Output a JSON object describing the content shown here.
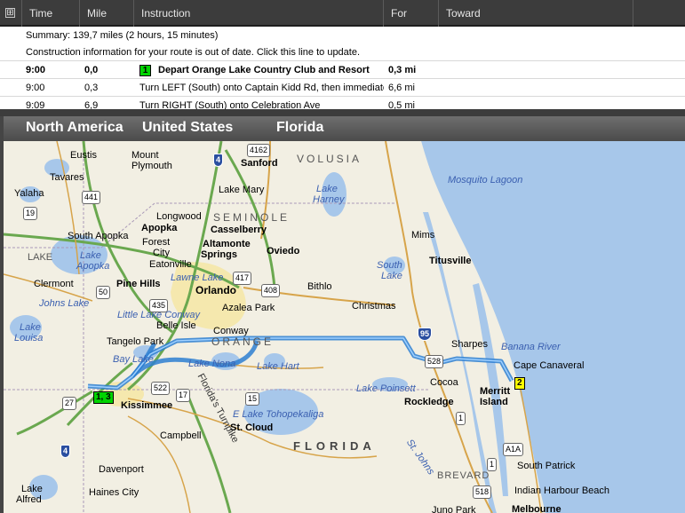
{
  "directions": {
    "expand_icon": "⊞",
    "columns": [
      "Time",
      "Mile",
      "Instruction",
      "For",
      "Toward"
    ],
    "summary": "Summary:  139,7 miles (2 hours, 15 minutes)",
    "construction": "Construction information for your route is out of date.  Click this line to update.",
    "steps": [
      {
        "time": "9:00",
        "mile": "0,0",
        "badge": "1",
        "instruction": "Depart Orange Lake Country Club and Resort",
        "for": "0,3 mi"
      },
      {
        "time": "9:00",
        "mile": "0,3",
        "instruction": "Turn LEFT (South) onto Captain Kidd Rd, then immediatel",
        "for": "6,6 mi"
      },
      {
        "time": "9:09",
        "mile": "6,9",
        "instruction": "Turn RIGHT (South) onto Celebration Ave",
        "for": "0,5 mi"
      }
    ]
  },
  "breadcrumb": [
    "North America",
    "United States",
    "Florida"
  ],
  "map": {
    "cities": [
      "Eustis",
      "Mount",
      "Plymouth",
      "Sanford",
      "Tavares",
      "Lake Mary",
      "Yalaha",
      "Longwood",
      "Apopka",
      "Casselberry",
      "South Apopka",
      "Forest",
      "City",
      "Altamonte",
      "Springs",
      "Oviedo",
      "Eatonville",
      "Clermont",
      "Pine Hills",
      "Orlando",
      "Bithlo",
      "Azalea Park",
      "Christmas",
      "Titusville",
      "Mims",
      "Belle Isle",
      "Conway",
      "Tangelo Park",
      "Sharpes",
      "Cape Canaveral",
      "Cocoa",
      "Merritt",
      "Island",
      "Kissimmee",
      "Rockledge",
      "St. Cloud",
      "Campbell",
      "Davenport",
      "Haines City",
      "Lake",
      "Alfred",
      "South Patrick",
      "Indian Harbour Beach",
      "Melbourne",
      "Juno Park",
      "BREVARD"
    ],
    "water": [
      "Lake",
      "Harney",
      "Mosquito Lagoon",
      "Lake",
      "Apopka",
      "LAKE",
      "South",
      "Lake",
      "Johns Lake",
      "Lake",
      "Louisa",
      "Little Lake Conway",
      "Lawne Lake",
      "Bay Lake",
      "Lake Nona",
      "Lake Hart",
      "Banana River",
      "Lake Poinsett",
      "E Lake Tohopekaliga",
      "St. Johns"
    ],
    "regions": [
      "VOLUSIA",
      "SEMINOLE",
      "ORANGE",
      "FLORIDA"
    ],
    "turnpike": "Florida's Turnpike",
    "shields": [
      "4162",
      "4",
      "441",
      "19",
      "50",
      "417",
      "408",
      "435",
      "95",
      "528",
      "522",
      "17",
      "15",
      "27",
      "4",
      "1",
      "A1A",
      "518",
      "1"
    ],
    "pins": [
      "1, 3",
      "2"
    ],
    "colors": {
      "land": "#f2efe3",
      "water": "#a7c7ea",
      "route": "#2e7fd1",
      "start_pin": "#00d400",
      "end_pin": "#ffff00"
    }
  }
}
